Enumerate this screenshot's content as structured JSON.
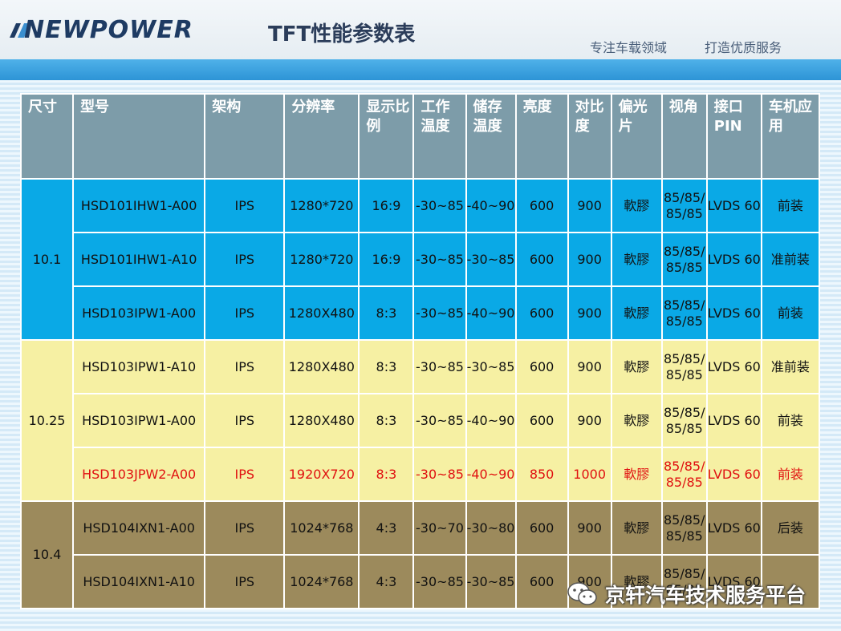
{
  "header": {
    "logo": "NEWPOWER",
    "title": "TFT性能参数表",
    "slogan_left": "专注车载领域",
    "slogan_right": "打造优质服务"
  },
  "table": {
    "columns": [
      "尺寸",
      "型号",
      "架构",
      "分辨率",
      "显示比例",
      "工作温度",
      "储存温度",
      "亮度",
      "对比度",
      "偏光片",
      "视角",
      "接口PIN",
      "车机应用"
    ],
    "groups": [
      {
        "size": "10.1",
        "color": "#0aa9e6",
        "rows": [
          {
            "model": "HSD101IHW1-A00",
            "arch": "IPS",
            "resolution": "1280*720",
            "ratio": "16:9",
            "work_temp": "-30~85",
            "store_temp": "-40~90",
            "brightness": "600",
            "contrast": "900",
            "polarizer": "軟膠",
            "view_angle": "85/85/ 85/85",
            "interface": "LVDS 60",
            "application": "前装",
            "highlight": false
          },
          {
            "model": "HSD101IHW1-A10",
            "arch": "IPS",
            "resolution": "1280*720",
            "ratio": "16:9",
            "work_temp": "-30~85",
            "store_temp": "-30~85",
            "brightness": "600",
            "contrast": "900",
            "polarizer": "軟膠",
            "view_angle": "85/85/ 85/85",
            "interface": "LVDS 60",
            "application": "准前装",
            "highlight": false
          },
          {
            "model": "HSD103IPW1-A00",
            "arch": "IPS",
            "resolution": "1280X480",
            "ratio": "8:3",
            "work_temp": "-30~85",
            "store_temp": "-40~90",
            "brightness": "600",
            "contrast": "900",
            "polarizer": "軟膠",
            "view_angle": "85/85/ 85/85",
            "interface": "LVDS 60",
            "application": "前装",
            "highlight": false
          }
        ]
      },
      {
        "size": "10.25",
        "color": "#f6f0a3",
        "rows": [
          {
            "model": "HSD103IPW1-A10",
            "arch": "IPS",
            "resolution": "1280X480",
            "ratio": "8:3",
            "work_temp": "-30~85",
            "store_temp": "-30~85",
            "brightness": "600",
            "contrast": "900",
            "polarizer": "軟膠",
            "view_angle": "85/85/ 85/85",
            "interface": "LVDS 60",
            "application": "准前装",
            "highlight": false
          },
          {
            "model": "HSD103IPW1-A00",
            "arch": "IPS",
            "resolution": "1280X480",
            "ratio": "8:3",
            "work_temp": "-30~85",
            "store_temp": "-40~90",
            "brightness": "600",
            "contrast": "900",
            "polarizer": "軟膠",
            "view_angle": "85/85/ 85/85",
            "interface": "LVDS 60",
            "application": "前装",
            "highlight": false
          },
          {
            "model": "HSD103JPW2-A00",
            "arch": "IPS",
            "resolution": "1920X720",
            "ratio": "8:3",
            "work_temp": "-30~85",
            "store_temp": "-40~90",
            "brightness": "850",
            "contrast": "1000",
            "polarizer": "軟膠",
            "view_angle": "85/85/ 85/85",
            "interface": "LVDS 60",
            "application": "前装",
            "highlight": true
          }
        ]
      },
      {
        "size": "10.4",
        "color": "#9c8a5c",
        "rows": [
          {
            "model": "HSD104IXN1-A00",
            "arch": "IPS",
            "resolution": "1024*768",
            "ratio": "4:3",
            "work_temp": "-30~70",
            "store_temp": "-30~80",
            "brightness": "600",
            "contrast": "900",
            "polarizer": "軟膠",
            "view_angle": "85/85/ 85/85",
            "interface": "LVDS 60",
            "application": "后装",
            "highlight": false
          },
          {
            "model": "HSD104IXN1-A10",
            "arch": "IPS",
            "resolution": "1024*768",
            "ratio": "4:3",
            "work_temp": "-30~85",
            "store_temp": "-30~85",
            "brightness": "600",
            "contrast": "900",
            "polarizer": "軟膠",
            "view_angle": "85/85/ 85/85",
            "interface": "LVDS 60",
            "application": "",
            "highlight": false
          }
        ]
      }
    ],
    "highlight_color": "#e01010"
  },
  "watermark": {
    "text": "京轩汽车技术服务平台",
    "icon": "wechat-icon"
  }
}
